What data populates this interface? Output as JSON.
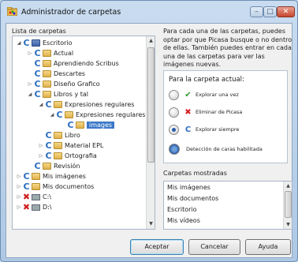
{
  "window": {
    "title": "Administrador de carpetas"
  },
  "tree": {
    "label": "Lista de carpetas",
    "rows": [
      {
        "label": "Escritorio"
      },
      {
        "label": "Actual"
      },
      {
        "label": "Aprendiendo Scribus"
      },
      {
        "label": "Descartes"
      },
      {
        "label": "Diseño Grafico"
      },
      {
        "label": "Libros y tal"
      },
      {
        "label": "Expresiones regulares"
      },
      {
        "label": "Expresiones regulares."
      },
      {
        "label": "images"
      },
      {
        "label": "Libro"
      },
      {
        "label": "Material EPL"
      },
      {
        "label": "Ortografia"
      },
      {
        "label": "Revisión"
      },
      {
        "label": "Mis imágenes"
      },
      {
        "label": "Mis documentos"
      },
      {
        "label": "C:\\"
      },
      {
        "label": "D:\\"
      }
    ]
  },
  "description": "Para cada una de las carpetas, puedes optar por que Picasa busque o no dentro de ellas. También puedes entrar en cada una de las carpetas para ver las imágenes nuevas.",
  "options": {
    "title": "Para la carpeta actual:",
    "once": "Explorar una vez",
    "remove": "Eliminar de Picasa",
    "always": "Explorar siempre",
    "face": "Detección de caras habilitada",
    "selected": "always"
  },
  "shown": {
    "label": "Carpetas mostradas",
    "items": [
      "Mis imágenes",
      "Mis documentos",
      "Escritorio",
      "Mis vídeos"
    ]
  },
  "buttons": {
    "accept": "Aceptar",
    "cancel": "Cancelar",
    "help": "Ayuda"
  },
  "colors": {
    "accent": "#3a78c8",
    "title_bar": "#bcd3ea"
  },
  "icons": [
    "picasa-icon",
    "folder-icon",
    "expand-arrow-icon",
    "check-icon",
    "x-icon",
    "face-detection-icon"
  ]
}
